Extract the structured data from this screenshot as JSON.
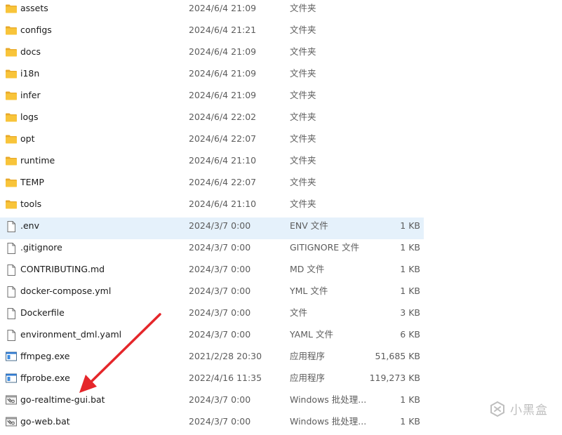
{
  "files": [
    {
      "name": "assets",
      "date": "2024/6/4 21:09",
      "type": "文件夹",
      "size": "",
      "icon": "folder-icon"
    },
    {
      "name": "configs",
      "date": "2024/6/4 21:21",
      "type": "文件夹",
      "size": "",
      "icon": "folder-icon"
    },
    {
      "name": "docs",
      "date": "2024/6/4 21:09",
      "type": "文件夹",
      "size": "",
      "icon": "folder-icon"
    },
    {
      "name": "i18n",
      "date": "2024/6/4 21:09",
      "type": "文件夹",
      "size": "",
      "icon": "folder-icon"
    },
    {
      "name": "infer",
      "date": "2024/6/4 21:09",
      "type": "文件夹",
      "size": "",
      "icon": "folder-icon"
    },
    {
      "name": "logs",
      "date": "2024/6/4 22:02",
      "type": "文件夹",
      "size": "",
      "icon": "folder-icon"
    },
    {
      "name": "opt",
      "date": "2024/6/4 22:07",
      "type": "文件夹",
      "size": "",
      "icon": "folder-icon"
    },
    {
      "name": "runtime",
      "date": "2024/6/4 21:10",
      "type": "文件夹",
      "size": "",
      "icon": "folder-icon"
    },
    {
      "name": "TEMP",
      "date": "2024/6/4 22:07",
      "type": "文件夹",
      "size": "",
      "icon": "folder-icon"
    },
    {
      "name": "tools",
      "date": "2024/6/4 21:10",
      "type": "文件夹",
      "size": "",
      "icon": "folder-icon"
    },
    {
      "name": ".env",
      "date": "2024/3/7 0:00",
      "type": "ENV 文件",
      "size": "1 KB",
      "icon": "document-icon",
      "selected": true
    },
    {
      "name": ".gitignore",
      "date": "2024/3/7 0:00",
      "type": "GITIGNORE 文件",
      "size": "1 KB",
      "icon": "document-icon"
    },
    {
      "name": "CONTRIBUTING.md",
      "date": "2024/3/7 0:00",
      "type": "MD 文件",
      "size": "1 KB",
      "icon": "document-icon"
    },
    {
      "name": "docker-compose.yml",
      "date": "2024/3/7 0:00",
      "type": "YML 文件",
      "size": "1 KB",
      "icon": "document-icon"
    },
    {
      "name": "Dockerfile",
      "date": "2024/3/7 0:00",
      "type": "文件",
      "size": "3 KB",
      "icon": "document-icon"
    },
    {
      "name": "environment_dml.yaml",
      "date": "2024/3/7 0:00",
      "type": "YAML 文件",
      "size": "6 KB",
      "icon": "document-icon"
    },
    {
      "name": "ffmpeg.exe",
      "date": "2021/2/28 20:30",
      "type": "应用程序",
      "size": "51,685 KB",
      "icon": "application-icon"
    },
    {
      "name": "ffprobe.exe",
      "date": "2022/4/16 11:35",
      "type": "应用程序",
      "size": "119,273 KB",
      "icon": "application-icon"
    },
    {
      "name": "go-realtime-gui.bat",
      "date": "2024/3/7 0:00",
      "type": "Windows 批处理...",
      "size": "1 KB",
      "icon": "batch-file-icon"
    },
    {
      "name": "go-web.bat",
      "date": "2024/3/7 0:00",
      "type": "Windows 批处理...",
      "size": "1 KB",
      "icon": "batch-file-icon"
    }
  ],
  "annotation": {
    "arrow_color": "#e5262a",
    "points_to": "go-realtime-gui.bat"
  },
  "watermark": {
    "text": "小黑盒",
    "icon": "xiaoheihe-logo-icon"
  },
  "colors": {
    "selected_row": "#e5f1fb",
    "folder": "#f8c43a",
    "secondary_text": "#5c5c5c"
  }
}
